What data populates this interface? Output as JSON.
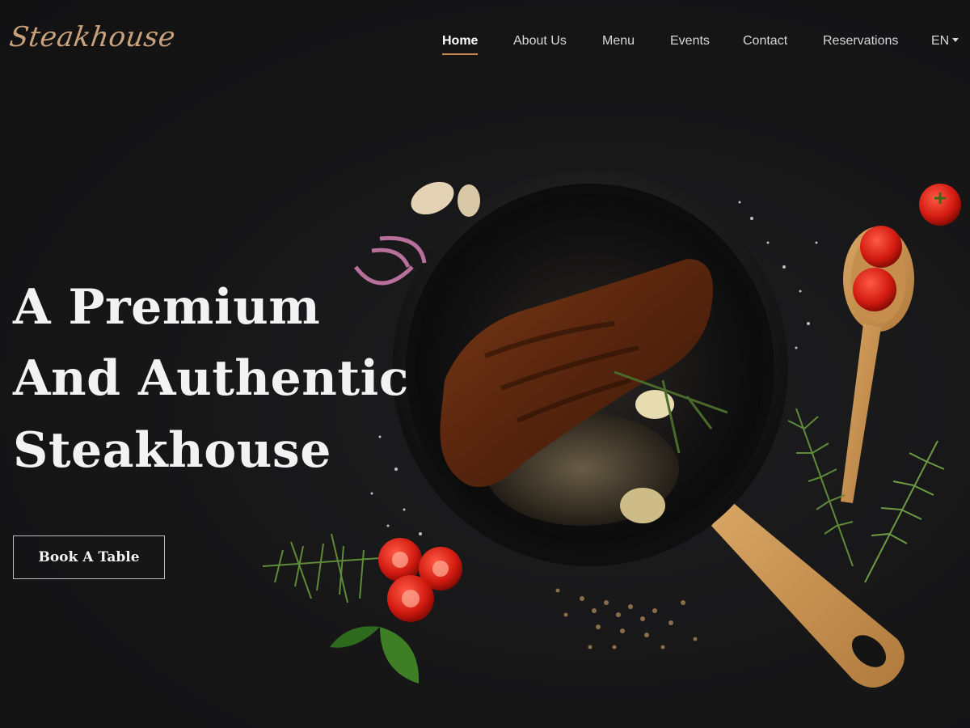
{
  "brand": {
    "logo_text": "Steakhouse"
  },
  "nav": {
    "items": [
      {
        "label": "Home",
        "active": true
      },
      {
        "label": "About Us",
        "active": false
      },
      {
        "label": "Menu",
        "active": false
      },
      {
        "label": "Events",
        "active": false
      },
      {
        "label": "Contact",
        "active": false
      },
      {
        "label": "Reservations",
        "active": false
      }
    ],
    "language": "EN"
  },
  "hero": {
    "heading_lines": [
      "A Premium",
      "And Authentic",
      "Steakhouse"
    ],
    "cta_label": "Book A Table"
  },
  "colors": {
    "background": "#151516",
    "accent": "#c98a52",
    "logo": "#c9a27a",
    "text": "#f2f2f2"
  },
  "icons": {
    "language_dropdown": "chevron-down-icon"
  }
}
